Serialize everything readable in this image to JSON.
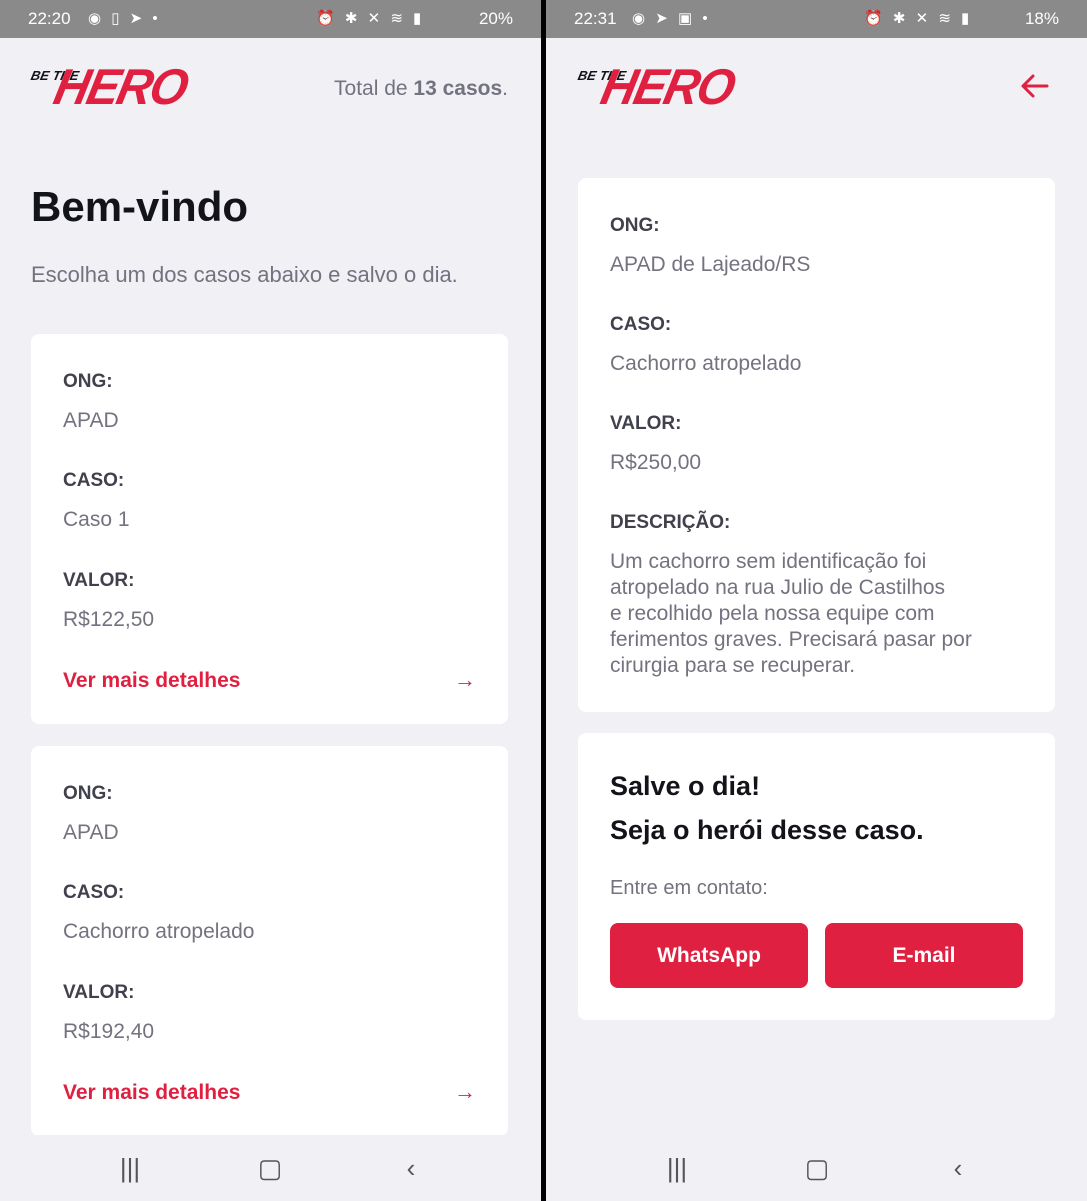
{
  "screen1": {
    "status": {
      "time": "22:20",
      "battery": "20%"
    },
    "logo": {
      "be_the": "BE THE",
      "hero": "HERO"
    },
    "header": {
      "total_prefix": "Total de ",
      "total_bold": "13 casos",
      "total_suffix": "."
    },
    "title": "Bem-vindo",
    "subtitle": "Escolha um dos casos abaixo e salvo o dia.",
    "cases": [
      {
        "ong_label": "ONG:",
        "ong": "APAD",
        "caso_label": "CASO:",
        "caso": "Caso 1",
        "valor_label": "VALOR:",
        "valor": "R$122,50",
        "details_label": "Ver mais detalhes"
      },
      {
        "ong_label": "ONG:",
        "ong": "APAD",
        "caso_label": "CASO:",
        "caso": "Cachorro atropelado",
        "valor_label": "VALOR:",
        "valor": "R$192,40",
        "details_label": "Ver mais detalhes"
      }
    ]
  },
  "screen2": {
    "status": {
      "time": "22:31",
      "battery": "18%"
    },
    "logo": {
      "be_the": "BE THE",
      "hero": "HERO"
    },
    "incident": {
      "ong_label": "ONG:",
      "ong": "APAD de Lajeado/RS",
      "caso_label": "CASO:",
      "caso": "Cachorro atropelado",
      "valor_label": "VALOR:",
      "valor": "R$250,00",
      "desc_label": "DESCRIÇÃO:",
      "desc_lines": [
        "Um cachorro sem identificação foi",
        "atropelado na rua Julio de Castilhos",
        "e recolhido pela nossa equipe com",
        "ferimentos graves. Precisará pasar por",
        "cirurgia para se recuperar."
      ]
    },
    "contact": {
      "title_line1": "Salve o dia!",
      "title_line2": "Seja o herói desse caso.",
      "prompt": "Entre em contato:",
      "whatsapp_label": "WhatsApp",
      "email_label": "E-mail"
    }
  },
  "colors": {
    "accent": "#e02041",
    "background": "#f0f0f5",
    "card": "#ffffff",
    "text_dark": "#13131a",
    "text_muted": "#737380"
  },
  "icons": {
    "back": "arrow-left-icon",
    "details": "arrow-right-icon"
  }
}
